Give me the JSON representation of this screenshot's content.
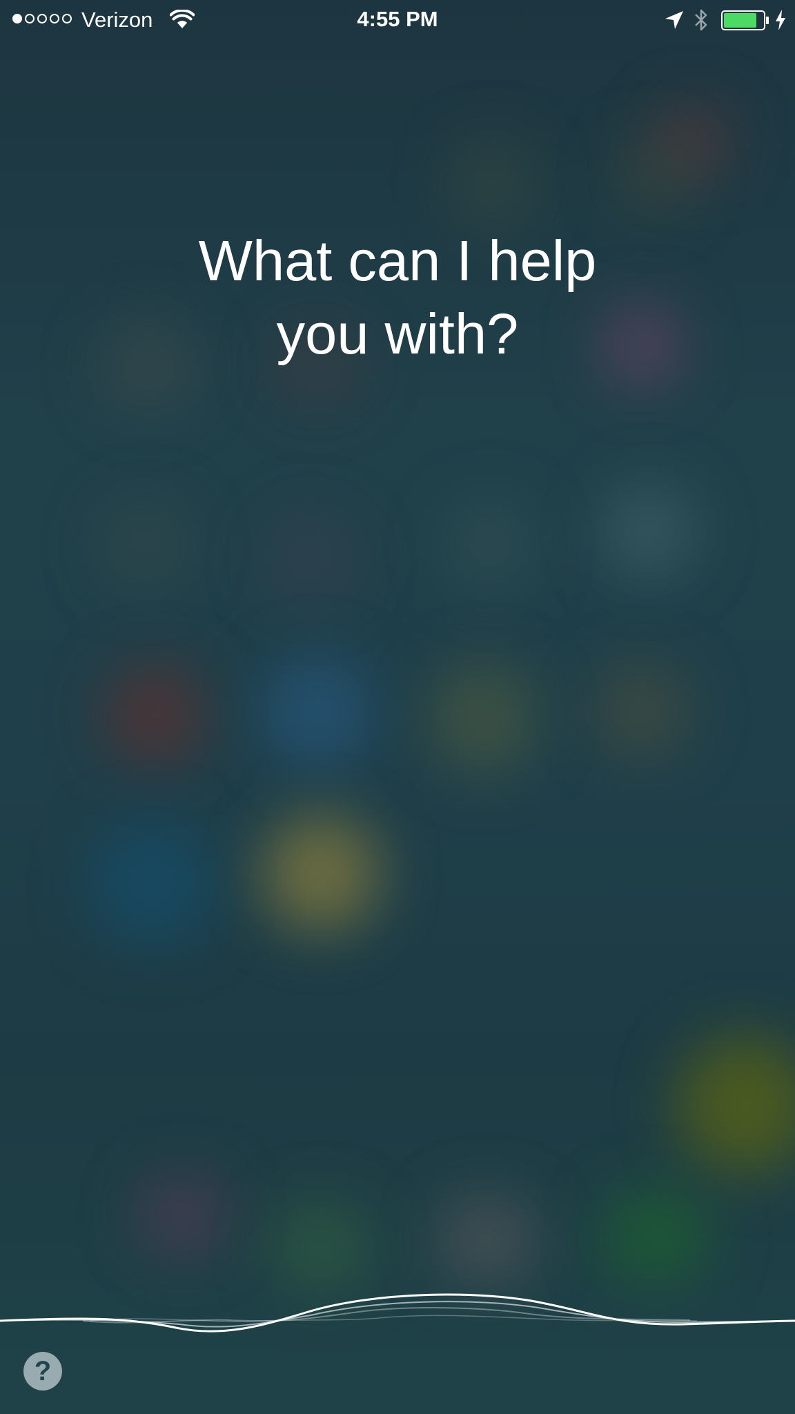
{
  "status_bar": {
    "signal_bars_filled": 1,
    "signal_bars_total": 5,
    "carrier": "Verizon",
    "time": "4:55 PM",
    "battery_color": "#4cd964"
  },
  "siri": {
    "prompt_line1": "What can I help",
    "prompt_line2": "you with?",
    "help_label": "?"
  },
  "icons": [
    "wifi-icon",
    "location-arrow-icon",
    "bluetooth-icon",
    "battery-icon",
    "charging-bolt-icon",
    "help-icon",
    "siri-waveform"
  ]
}
